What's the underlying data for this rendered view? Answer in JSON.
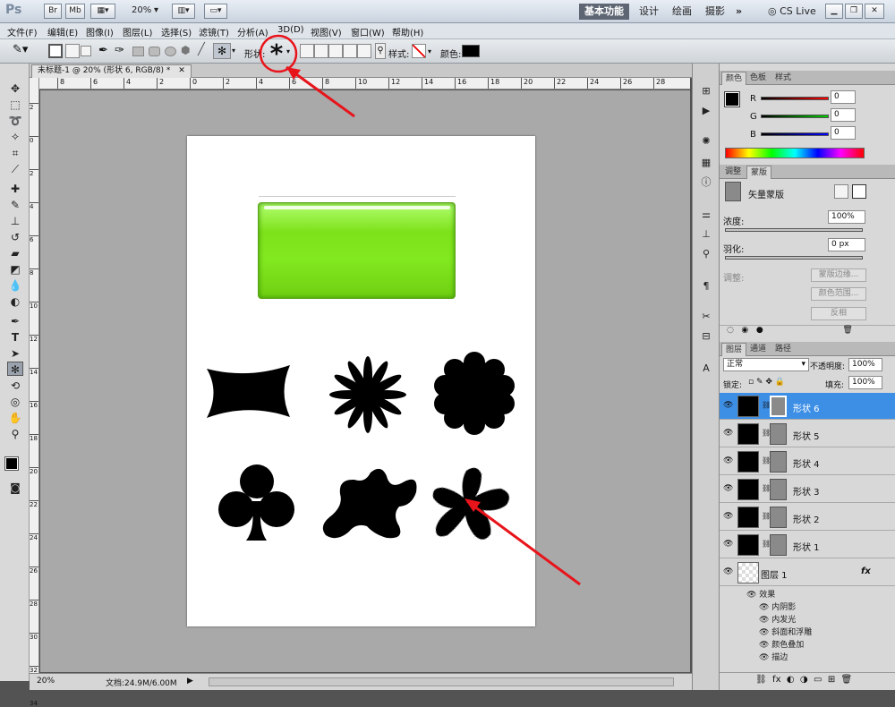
{
  "titlebar": {
    "app_logo": "Ps",
    "br_icon": "Br",
    "mb_icon": "Mb",
    "zoom": "20%",
    "workspaces": [
      "基本功能",
      "设计",
      "绘画",
      "摄影"
    ],
    "more": "»",
    "cslive": "CS Live"
  },
  "menu": [
    "文件(F)",
    "编辑(E)",
    "图像(I)",
    "图层(L)",
    "选择(S)",
    "滤镜(T)",
    "分析(A)",
    "3D(D)",
    "视图(V)",
    "窗口(W)",
    "帮助(H)"
  ],
  "options": {
    "shape_label": "形状:",
    "shape_glyph": "*",
    "style_label": "样式:",
    "color_label": "颜色:",
    "color_value": "#000000"
  },
  "document": {
    "tab_title": "未标题-1 @ 20% (形状 6, RGB/8) *",
    "ruler_h": [
      "8",
      "6",
      "4",
      "2",
      "0",
      "2",
      "4",
      "6",
      "8",
      "10",
      "12",
      "14",
      "16",
      "18",
      "20",
      "22",
      "24",
      "26",
      "28"
    ],
    "ruler_v": [
      "2",
      "0",
      "2",
      "4",
      "6",
      "8",
      "10",
      "12",
      "14",
      "16",
      "18",
      "20",
      "22",
      "24",
      "26",
      "28",
      "30",
      "32",
      "34"
    ]
  },
  "status": {
    "zoom": "20%",
    "doc_info": "文档:24.9M/6.00M"
  },
  "color_panel": {
    "tabs": [
      "颜色",
      "色板",
      "样式"
    ],
    "channels": [
      {
        "name": "R",
        "value": "0"
      },
      {
        "name": "G",
        "value": "0"
      },
      {
        "name": "B",
        "value": "0"
      }
    ]
  },
  "adjust_panel": {
    "tabs": [
      "调整",
      "蒙版"
    ],
    "mask_type": "矢量蒙版",
    "density_label": "浓度:",
    "density_value": "100%",
    "feather_label": "羽化:",
    "feather_value": "0 px",
    "refine_label": "调整:",
    "buttons": [
      "蒙版边缘...",
      "颜色范围...",
      "反相"
    ]
  },
  "layers_panel": {
    "tabs": [
      "图层",
      "通道",
      "路径"
    ],
    "blend_mode": "正常",
    "opacity_label": "不透明度:",
    "opacity_value": "100%",
    "lock_label": "锁定:",
    "fill_label": "填充:",
    "fill_value": "100%",
    "layers": [
      {
        "name": "形状 6",
        "selected": true
      },
      {
        "name": "形状 5",
        "selected": false
      },
      {
        "name": "形状 4",
        "selected": false
      },
      {
        "name": "形状 3",
        "selected": false
      },
      {
        "name": "形状 2",
        "selected": false
      },
      {
        "name": "形状 1",
        "selected": false
      }
    ],
    "layer1": {
      "name": "图层 1",
      "fx": "fx",
      "effects_label": "效果",
      "effects": [
        "内阴影",
        "内发光",
        "斜面和浮雕",
        "颜色叠加",
        "描边"
      ]
    }
  },
  "colors": {
    "selected_layer": "#3d8fe6",
    "annotation_red": "#e8141b",
    "shape_green": "#82e81f"
  }
}
